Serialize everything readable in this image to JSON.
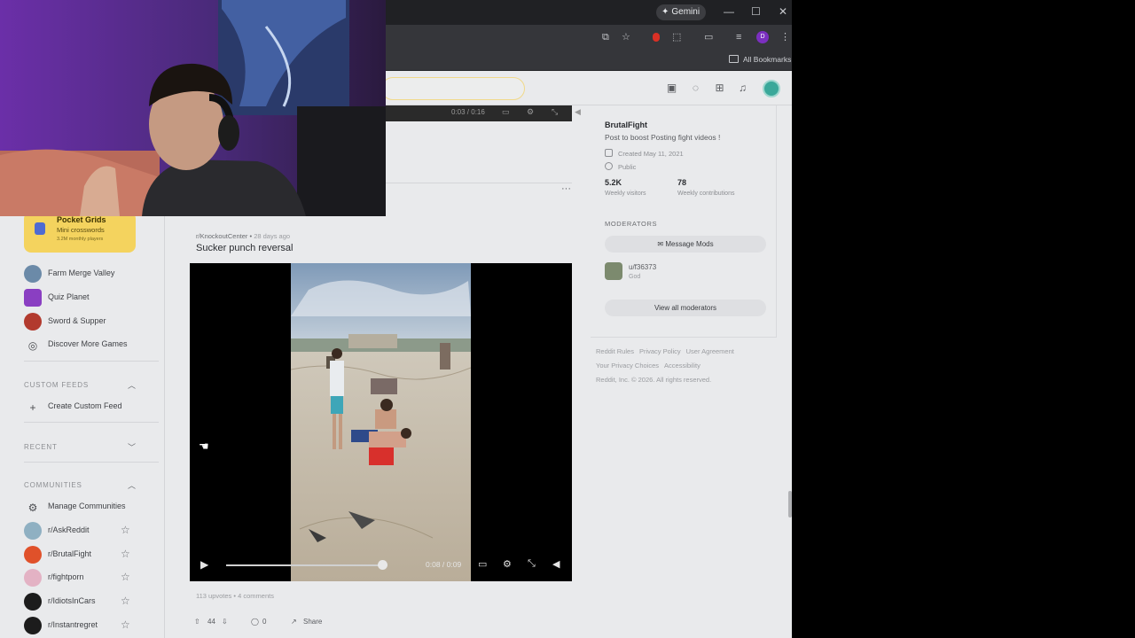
{
  "browser": {
    "gemini_label": "Gemini",
    "bookmarks_label": "All Bookmarks",
    "profile_initial": "D"
  },
  "sidebar": {
    "featured_game": {
      "title": "Pocket Grids",
      "subtitle": "Mini crosswords",
      "meta": "3.2M monthly players"
    },
    "games": [
      {
        "label": "Farm Merge Valley",
        "color": "#6b8aa8"
      },
      {
        "label": "Quiz Planet",
        "color": "#8a3fc2"
      },
      {
        "label": "Sword & Supper",
        "color": "#b23a2e"
      },
      {
        "label": "Discover More Games",
        "icon": "gamepad-icon"
      }
    ],
    "custom_feeds": {
      "header": "CUSTOM FEEDS",
      "create_label": "Create Custom Feed"
    },
    "recent": {
      "header": "RECENT"
    },
    "communities": {
      "header": "COMMUNITIES",
      "manage_label": "Manage Communities",
      "items": [
        {
          "label": "r/AskReddit",
          "color": "#8fb0c2"
        },
        {
          "label": "r/BrutalFight",
          "color": "#e0512a"
        },
        {
          "label": "r/fightporn",
          "color": "#e3b2c4"
        },
        {
          "label": "r/IdiotsInCars",
          "color": "#1c1c1c"
        },
        {
          "label": "r/Instantregret",
          "color": "#1c1c1c"
        }
      ]
    }
  },
  "feed": {
    "prev_video_time": "0:03 / 0:16",
    "post": {
      "subreddit": "r/KnockoutCenter",
      "age": "28 days ago",
      "title": "Sucker punch reversal",
      "video_time": "0:08 / 0:09",
      "video_progress": 0.89,
      "upvotes_text": "113 upvotes",
      "comments_text": "4 comments",
      "vote_count": "44",
      "comment_count": "0",
      "share_label": "Share"
    }
  },
  "community_panel": {
    "name": "BrutalFight",
    "description": "Post to boost Posting fight videos !",
    "created": "Created May 11, 2021",
    "visibility": "Public",
    "visitors_value": "5.2K",
    "visitors_label": "Weekly visitors",
    "contrib_value": "78",
    "contrib_label": "Weekly contributions",
    "moderators_header": "MODERATORS",
    "message_mods_label": "Message Mods",
    "mod_name": "u/f36373",
    "mod_flair": "God",
    "view_all_label": "View all moderators"
  },
  "footer": {
    "line1": [
      "Reddit Rules",
      "Privacy Policy",
      "User Agreement"
    ],
    "line2": [
      "Your Privacy Choices",
      "Accessibility"
    ],
    "line3": "Reddit, Inc. © 2026. All rights reserved."
  }
}
